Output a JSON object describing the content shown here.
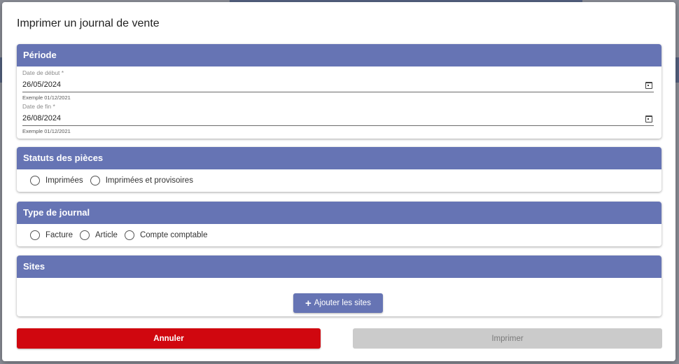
{
  "dialog": {
    "title": "Imprimer un journal de vente"
  },
  "periode": {
    "header": "Période",
    "start": {
      "label": "Date de début *",
      "value": "26/05/2024",
      "hint": "Exemple 01/12/2021"
    },
    "end": {
      "label": "Date de fin *",
      "value": "26/08/2024",
      "hint": "Exemple 01/12/2021"
    }
  },
  "statuts": {
    "header": "Statuts des pièces",
    "options": [
      "Imprimées",
      "Imprimées et provisoires"
    ]
  },
  "type_journal": {
    "header": "Type de journal",
    "options": [
      "Facture",
      "Article",
      "Compte comptable"
    ]
  },
  "sites": {
    "header": "Sites",
    "add_label": "Ajouter les sites"
  },
  "actions": {
    "cancel_label": "Annuler",
    "print_label": "Imprimer"
  },
  "icons": {
    "calendar": "calendar-icon",
    "plus": "plus-icon"
  },
  "colors": {
    "header": "#6674b4",
    "cancel": "#d0070f",
    "disabled": "#cbcbcb"
  }
}
